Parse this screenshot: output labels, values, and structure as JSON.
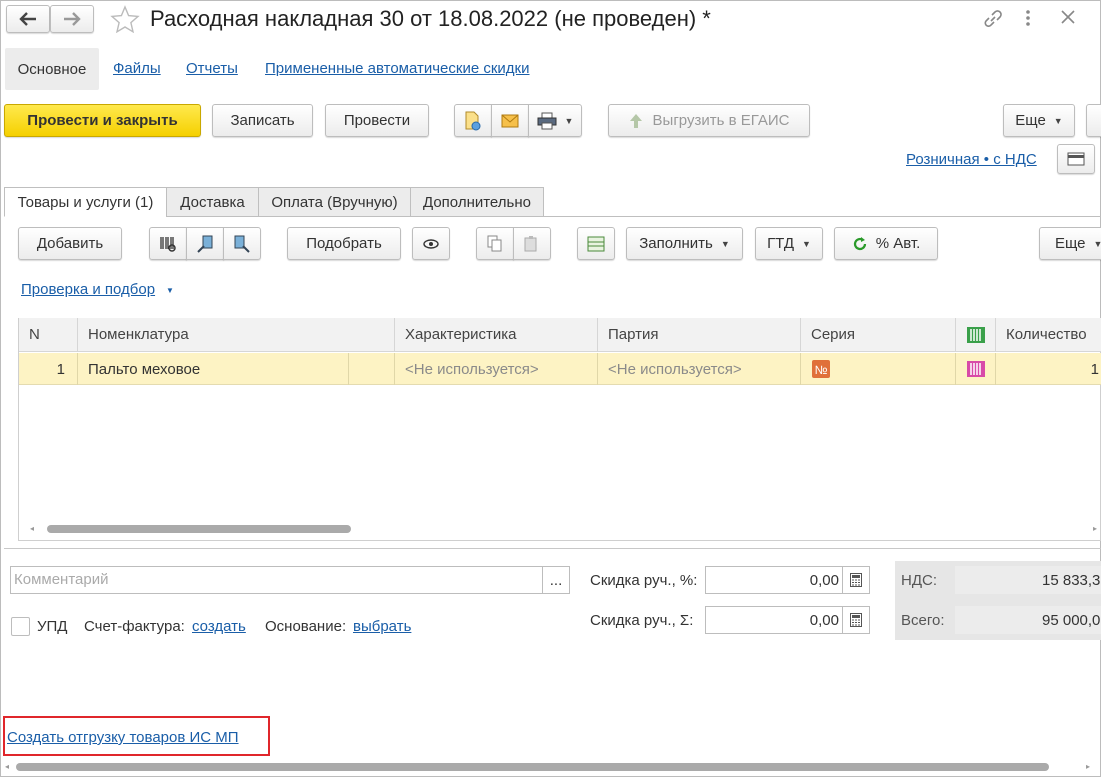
{
  "window": {
    "title": "Расходная накладная 30 от 18.08.2022 (не проведен) *"
  },
  "nav_tabs": [
    "Основное",
    "Файлы",
    "Отчеты",
    "Примененные автоматические скидки"
  ],
  "toolbar": {
    "post_and_close": "Провести и закрыть",
    "save": "Записать",
    "post": "Провести",
    "upload_egais": "Выгрузить в ЕГАИС",
    "more": "Еще"
  },
  "price_type_link": "Розничная • с НДС",
  "doc_tabs": [
    "Товары и услуги (1)",
    "Доставка",
    "Оплата (Вручную)",
    "Дополнительно"
  ],
  "grid_toolbar": {
    "add": "Добавить",
    "pick": "Подобрать",
    "fill": "Заполнить",
    "gtd": "ГТД",
    "auto_pct": "% Авт.",
    "more": "Еще"
  },
  "check_link": "Проверка и подбор",
  "table": {
    "columns": [
      "N",
      "Номенклатура",
      "Характеристика",
      "Партия",
      "Серия",
      "Количество"
    ],
    "rows": [
      {
        "n": "1",
        "item": "Пальто меховое",
        "characteristic": "<Не используется>",
        "batch": "<Не используется>",
        "qty": "1"
      }
    ]
  },
  "footer": {
    "comment_placeholder": "Комментарий",
    "more_btn": "...",
    "discount_pct_label": "Скидка руч., %:",
    "discount_pct_value": "0,00",
    "discount_sum_label": "Скидка руч., Σ:",
    "discount_sum_value": "0,00",
    "vat_label": "НДС:",
    "vat_value": "15 833,3",
    "total_label": "Всего:",
    "total_value": "95 000,0",
    "upd_label": "УПД",
    "invoice_label": "Счет-фактура:",
    "invoice_link": "создать",
    "basis_label": "Основание:",
    "basis_link": "выбрать",
    "create_shipment_link": "Создать отгрузку товаров ИС МП"
  },
  "colors": {
    "accent_yellow": "#f5d000",
    "link_blue": "#1a5ea8",
    "selected_row": "#fdf3c4",
    "highlight_red": "#e0262b"
  }
}
